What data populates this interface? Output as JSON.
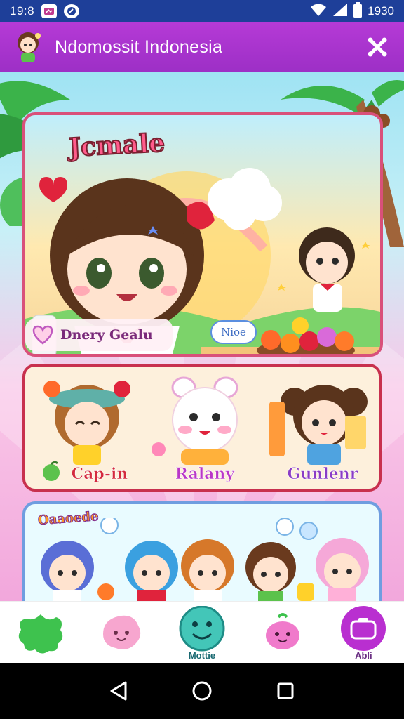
{
  "status_bar": {
    "time": "19:8",
    "battery_text": "1930",
    "icons": [
      "notification-icon",
      "vpn-icon",
      "wifi-icon",
      "signal-icon",
      "battery-icon"
    ]
  },
  "app_header": {
    "title": "Ndomossit Indonesia",
    "close_icon": "close-x-icon",
    "accent": "#a934cf"
  },
  "hero": {
    "title": "Jcmale",
    "caption": "Dnery Gealu",
    "speech_bubble": "Nioe",
    "border_color": "#d9507a"
  },
  "friends": {
    "items": [
      {
        "label": "Cap-in",
        "icon": "girl-character-icon"
      },
      {
        "label": "Ralany",
        "icon": "bunny-character-icon"
      },
      {
        "label": "Gunlenr",
        "icon": "pigtail-girl-icon"
      }
    ],
    "border_color": "#c8304e"
  },
  "group": {
    "title": "Oaaoede"
  },
  "bottom_nav": {
    "items": [
      {
        "icon": "green-splat-icon",
        "label": ""
      },
      {
        "icon": "pink-blob-icon",
        "label": ""
      },
      {
        "icon": "smiley-face-icon",
        "label": "Mottie"
      },
      {
        "icon": "pink-critter-icon",
        "label": ""
      },
      {
        "icon": "camera-icon",
        "label": "Abli"
      }
    ]
  },
  "system_nav": {
    "icons": [
      "back-triangle-icon",
      "home-circle-icon",
      "recents-square-icon"
    ]
  }
}
